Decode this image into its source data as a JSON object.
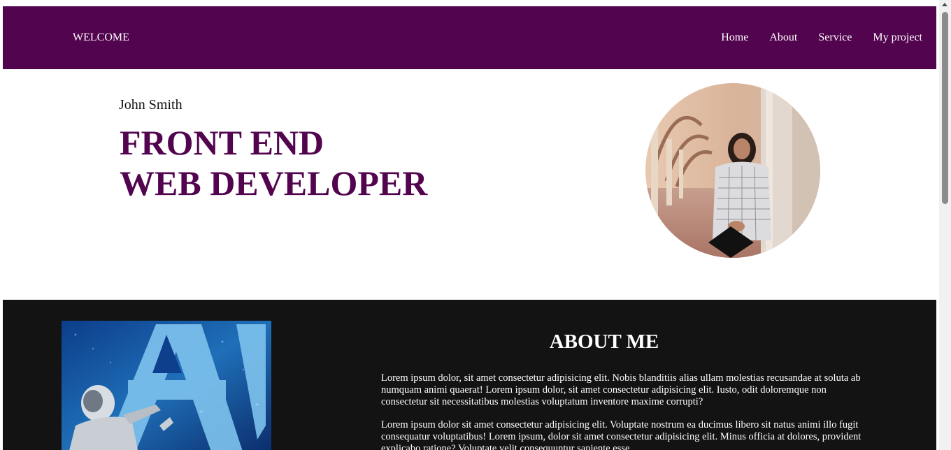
{
  "navbar": {
    "brand": "WELCOME",
    "links": [
      "Home",
      "About",
      "Service",
      "My project"
    ]
  },
  "hero": {
    "name": "John Smith",
    "title_line1": "FRONT END",
    "title_line2": "WEB DEVELOPER",
    "photo": "profile-photo"
  },
  "about": {
    "title": "ABOUT ME",
    "paragraph1": "Lorem ipsum dolor, sit amet consectetur adipisicing elit. Nobis blanditiis alias ullam molestias recusandae at soluta ab numquam animi quaerat! Lorem ipsum dolor, sit amet consectetur adipisicing elit. Iusto, odit doloremque non consectetur sit necessitatibus molestias voluptatum inventore maxime corrupti?",
    "paragraph2": "Lorem ipsum dolor sit amet consectetur adipisicing elit. Voluptate nostrum ea ducimus libero sit natus animi illo fugit consequatur voluptatibus! Lorem ipsum, dolor sit amet consectetur adipisicing elit. Minus officia at dolores, provident explicabo ratione? Voluptate velit consequuntur sapiente esse.",
    "image": "ai-robot-image"
  },
  "colors": {
    "accent": "#52044f",
    "dark_section": "#131313"
  }
}
